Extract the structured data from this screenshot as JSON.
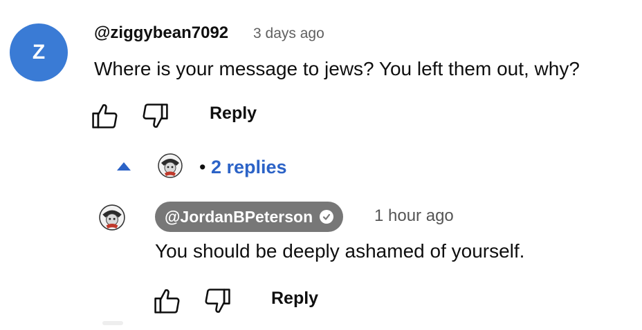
{
  "comment": {
    "avatar_letter": "Z",
    "avatar_color": "#3a7bd5",
    "handle": "@ziggybean7092",
    "time": "3 days ago",
    "text": "Where is your message to jews? You left them out, why?",
    "reply_label": "Reply"
  },
  "replies_toggle": {
    "label": "2 replies",
    "separator": "•",
    "accent_color": "#2c63c7"
  },
  "reply": {
    "handle": "@JordanBPeterson",
    "verified": true,
    "time": "1 hour ago",
    "text": "You should be deeply ashamed of yourself.",
    "reply_label": "Reply"
  },
  "icons": {
    "like": "thumbs-up-icon",
    "dislike": "thumbs-down-icon",
    "collapse": "caret-up-icon",
    "verified": "checkmark-badge-icon"
  }
}
